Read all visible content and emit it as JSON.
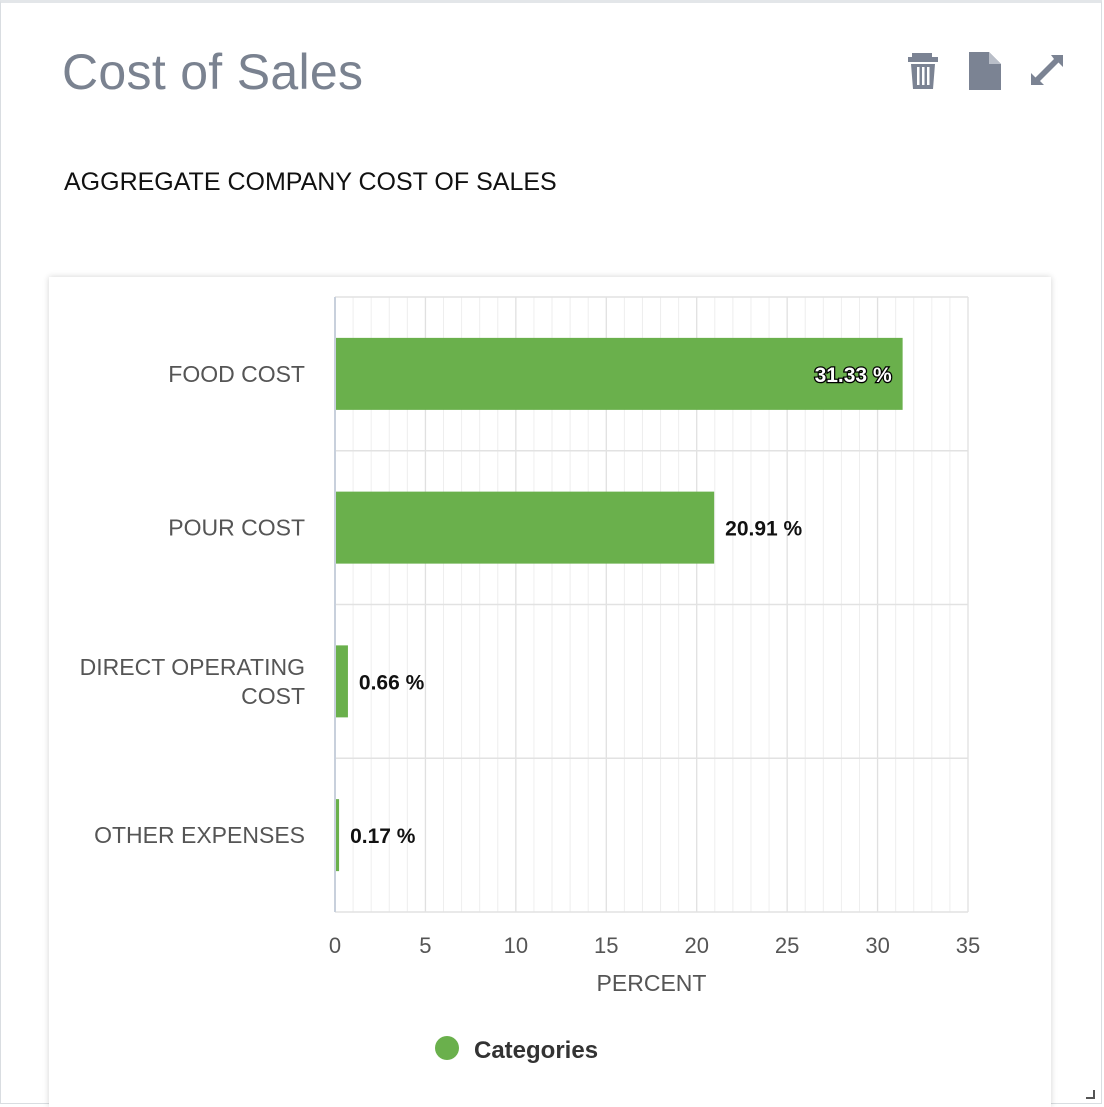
{
  "widget": {
    "title": "Cost of Sales",
    "subtitle": "AGGREGATE COMPANY COST OF SALES",
    "toolbar": [
      {
        "label": "Delete",
        "icon": "trash-icon"
      },
      {
        "label": "Export",
        "icon": "document-icon"
      },
      {
        "label": "Expand",
        "icon": "expand-icon"
      }
    ]
  },
  "chart_data": {
    "type": "bar",
    "orientation": "horizontal",
    "categories": [
      [
        "FOOD COST"
      ],
      [
        "POUR COST"
      ],
      [
        "DIRECT OPERATING",
        "COST"
      ],
      [
        "OTHER EXPENSES"
      ]
    ],
    "series": [
      {
        "name": "Categories",
        "values": [
          31.33,
          20.91,
          0.66,
          0.17
        ],
        "color": "#6ab04c"
      }
    ],
    "data_labels": [
      "31.33 %",
      "20.91 %",
      "0.66 %",
      "0.17 %"
    ],
    "xlabel": "PERCENT",
    "xlim": [
      0,
      35
    ],
    "xticks": [
      0,
      5,
      10,
      15,
      20,
      25,
      30,
      35
    ],
    "grid": true,
    "legend": "bottom-center"
  }
}
